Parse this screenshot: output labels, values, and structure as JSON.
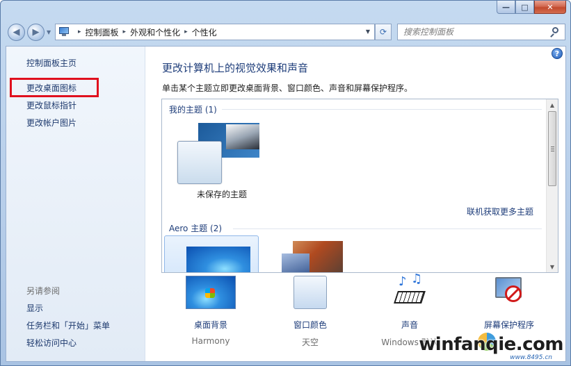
{
  "window": {
    "caption_minimize": "—",
    "caption_maximize": "□",
    "caption_close": "✕"
  },
  "nav": {
    "back": "◀",
    "forward": "▶",
    "dropdown": "▼",
    "breadcrumbs": [
      "控制面板",
      "外观和个性化",
      "个性化"
    ],
    "breadcrumb_separator": "▸",
    "refresh": "⟳",
    "search_placeholder": "搜索控制面板"
  },
  "sidebar": {
    "home": "控制面板主页",
    "links": [
      "更改桌面图标",
      "更改鼠标指针",
      "更改帐户图片"
    ],
    "see_also_heading": "另请参阅",
    "see_also": [
      "显示",
      "任务栏和「开始」菜单",
      "轻松访问中心"
    ]
  },
  "main": {
    "help": "?",
    "title": "更改计算机上的视觉效果和声音",
    "description": "单击某个主题立即更改桌面背景、窗口颜色、声音和屏幕保护程序。",
    "my_themes_heading": "我的主题 (1)",
    "unsaved_theme": "未保存的主题",
    "get_more_online": "联机获取更多主题",
    "aero_heading": "Aero 主题 (2)"
  },
  "bottom": {
    "items": [
      {
        "label": "桌面背景",
        "value": "Harmony"
      },
      {
        "label": "窗口颜色",
        "value": "天空"
      },
      {
        "label": "声音",
        "value": "Windows 默认"
      },
      {
        "label": "屏幕保护程序",
        "value": ""
      }
    ]
  },
  "watermark": {
    "text": "winfanqie.com",
    "sub": "www.8495.cn"
  },
  "colors": {
    "link": "#1e3d7a",
    "highlight": "#e0101e",
    "sidebar_bg": "#e8eff8"
  }
}
